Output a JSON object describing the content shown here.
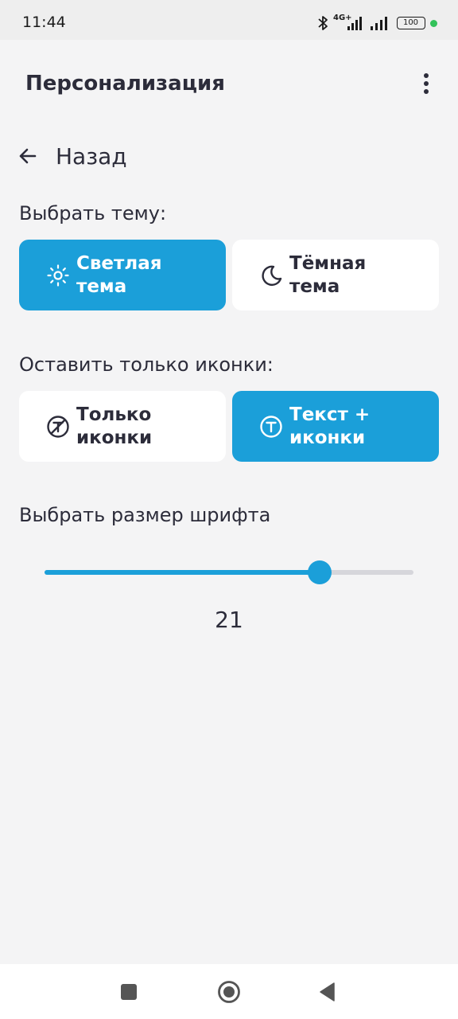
{
  "status_bar": {
    "time": "11:44",
    "network": "4G+",
    "battery": "100",
    "icons": [
      "bluetooth-icon",
      "signal-icon",
      "signal-icon",
      "battery-icon",
      "dot-icon"
    ]
  },
  "app_bar": {
    "title": "Персонализация",
    "menu_icon": "more-vertical-icon"
  },
  "back": {
    "label": "Назад",
    "icon": "arrow-left-icon"
  },
  "theme_section": {
    "label": "Выбрать тему:",
    "options": [
      {
        "line1": "Светлая",
        "line2": "тема",
        "icon": "sun-icon",
        "selected": true
      },
      {
        "line1": "Тёмная",
        "line2": "тема",
        "icon": "moon-icon",
        "selected": false
      }
    ]
  },
  "icons_section": {
    "label": "Оставить только иконки:",
    "options": [
      {
        "line1": "Только",
        "line2": "иконки",
        "icon": "text-off-icon",
        "selected": false
      },
      {
        "line1": "Текст +",
        "line2": "иконки",
        "icon": "text-icon",
        "selected": true
      }
    ]
  },
  "font_section": {
    "label": "Выбрать размер шрифта",
    "slider_fraction": 0.745,
    "value": "21"
  },
  "colors": {
    "accent": "#1b9fd9",
    "background": "#f4f4f5",
    "text": "#2c2c3a",
    "card": "#ffffff"
  },
  "nav_bar": {
    "buttons": [
      "recent-apps-icon",
      "home-icon",
      "back-triangle-icon"
    ]
  }
}
